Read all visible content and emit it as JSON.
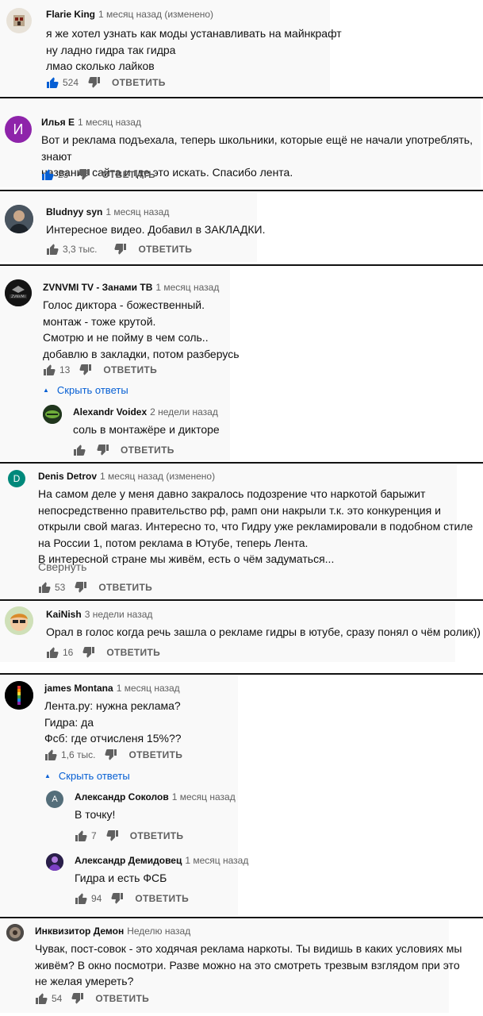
{
  "reply_label": "ОТВЕТИТЬ",
  "comments": [
    {
      "author": "Flarie King",
      "time": "1 месяц назад (изменено)",
      "text": "я же хотел узнать как моды устанавливать на майнкрафт\nну ладно гидра так гидра\nлмао сколько лайков",
      "likes": "524",
      "liked": true
    },
    {
      "author": "Илья Е",
      "avatar_letter": "И",
      "time": "1 месяц назад",
      "text": "Вот и реклама подъехала, теперь школьники, которые ещё не начали употреблять, знают\nназвание сайта и где это искать. Спасибо лента.",
      "likes": "23",
      "liked": true
    },
    {
      "author": "Bludnyy syn",
      "time": "1 месяц назад",
      "text": "Интересное видео. Добавил в ЗАКЛАДКИ.",
      "likes": "3,3 тыс."
    },
    {
      "author": "ZVNVMI TV - Занами ТВ",
      "time": "1 месяц назад",
      "text": "Голос диктора - божественный.\nмонтаж - тоже крутой.\nСмотрю и не пойму в чем соль..\nдобавлю в закладки, потом разберусь",
      "likes": "13",
      "toggle": "Скрыть ответы",
      "replies": [
        {
          "author": "Alexandr Voidex",
          "time": "2 недели назад",
          "text": "соль в монтажёре и дикторе",
          "likes": ""
        }
      ]
    },
    {
      "author": "Denis Detrov",
      "avatar_letter": "D",
      "time": "1 месяц назад (изменено)",
      "text": "На самом деле у меня давно закралось подозрение что наркотой барыжит\nнепосредственно правительство рф, рамп они накрыли т.к. это конкуренция и\nоткрыли свой магаз. Интересно то, что Гидру уже рекламировали в подобном стиле\nна России 1, потом реклама в Ютубе, теперь Лента.\nВ интересной стране мы живём, есть о чём задуматься...",
      "collapse": "Свернуть",
      "likes": "53"
    },
    {
      "author": "KaiNish",
      "time": "3 недели назад",
      "text": "Орал в голос когда речь зашла о рекламе гидры в ютубе, сразу понял о чём ролик))",
      "likes": "16"
    },
    {
      "author": "james Montana",
      "time": "1 месяц назад",
      "text": "Лента.ру: нужна реклама?\nГидра: да\nФсб: где отчисленя 15%??",
      "likes": "1,6 тыс.",
      "toggle": "Скрыть ответы",
      "replies": [
        {
          "author": "Александр Соколов",
          "avatar_letter": "A",
          "time": "1 месяц назад",
          "text": "В точку!",
          "likes": "7"
        },
        {
          "author": "Александр Демидовец",
          "time": "1 месяц назад",
          "text": "Гидра и есть ФСБ",
          "likes": "94"
        }
      ]
    },
    {
      "author": "Инквизитор Демон",
      "time": "Неделю назад",
      "text": "Чувак, пост-совок - это ходячая реклама наркоты. Ты видишь в каких условиях мы\nживём? В окно посмотри. Разве можно на это смотреть трезвым взглядом при это\nне желая умереть?",
      "likes": "54"
    }
  ],
  "colors": {
    "link": "#065fd4",
    "liked": "#065fd4",
    "meta": "#606060",
    "avatar_purple": "#8e24aa",
    "avatar_teal": "#00897b",
    "avatar_slate": "#546e7a"
  }
}
